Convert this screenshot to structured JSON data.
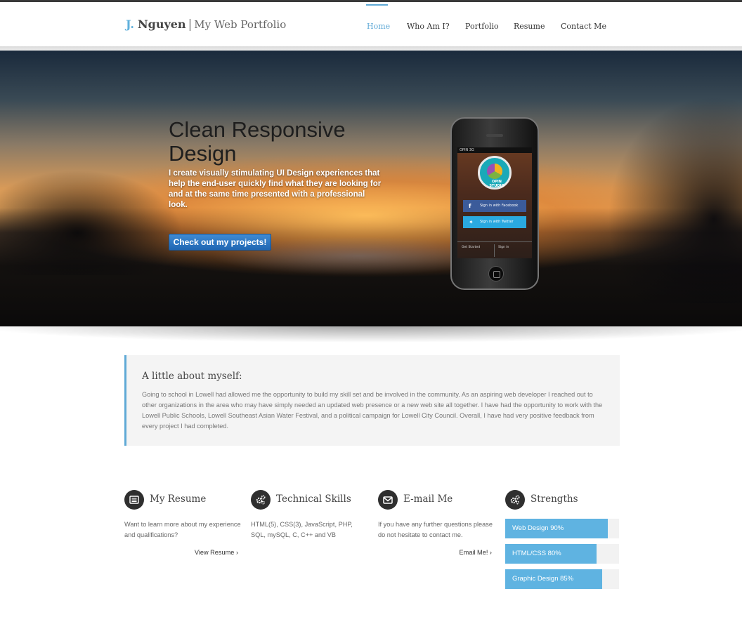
{
  "header": {
    "logo_initial": "J.",
    "logo_name": "Nguyen",
    "logo_sep": "|",
    "logo_tagline": "My Web Portfolio",
    "nav": [
      {
        "label": "Home",
        "active": true
      },
      {
        "label": "Who Am I?",
        "active": false
      },
      {
        "label": "Portfolio",
        "active": false
      },
      {
        "label": "Resume",
        "active": false
      },
      {
        "label": "Contact Me",
        "active": false
      }
    ]
  },
  "hero": {
    "title": "Clean Responsive Design",
    "text": "I create visually stimulating UI Design experiences that help the end-user quickly find what they are looking for and at the same time presented with a professional look.",
    "cta_label": "Check out my projects!",
    "phone": {
      "status_text": "OPIN  3G",
      "badge_text": "OPIN STUDIO",
      "facebook_label": "Sign in with Facebook",
      "twitter_label": "Sign in with Twitter",
      "footer_left": "Get Started",
      "footer_right": "Sign in"
    }
  },
  "about": {
    "title": "A little about myself:",
    "body": "Going to school in Lowell had allowed me the opportunity to build my skill set and be involved in the community. As an aspiring web developer I reached out to other organizations in the area who may have simply needed an updated web presence or a new web site all together. I have had the opportunity to work with the Lowell Public Schools, Lowell Southeast Asian Water Festival, and a political campaign for Lowell City Council. Overall, I have had very positive feedback from every project I had completed."
  },
  "features": {
    "resume": {
      "title": "My Resume",
      "desc": "Want to learn more about my experience and qualifications?",
      "link": "View Resume ›",
      "icon": "list-icon"
    },
    "skills": {
      "title": "Technical Skills",
      "desc": "HTML(5), CSS(3), JavaScript, PHP, SQL, mySQL, C, C++ and VB",
      "icon": "gears-icon"
    },
    "email": {
      "title": "E-mail Me",
      "desc": "If you have any further questions please do not hesitate to contact me.",
      "link": "Email Me! ›",
      "icon": "envelope-icon"
    },
    "strengths": {
      "title": "Strengths",
      "icon": "gears-icon",
      "items": [
        {
          "label": "Web Design 90%",
          "value": 90
        },
        {
          "label": "HTML/CSS 80%",
          "value": 80
        },
        {
          "label": "Graphic Design 85%",
          "value": 85
        }
      ]
    }
  },
  "colors": {
    "accent": "#5fa9d6",
    "bar_fill": "#5fb3e1",
    "cta": "#2a74c4"
  }
}
